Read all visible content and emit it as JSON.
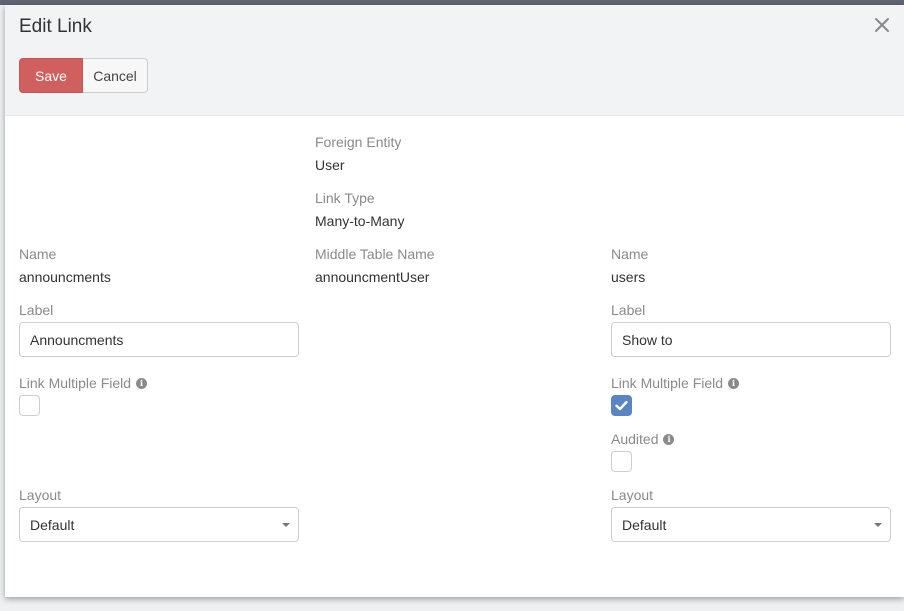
{
  "dialog": {
    "title": "Edit Link",
    "save_label": "Save",
    "cancel_label": "Cancel"
  },
  "center": {
    "foreign_entity_label": "Foreign Entity",
    "foreign_entity_value": "User",
    "link_type_label": "Link Type",
    "link_type_value": "Many-to-Many",
    "middle_table_label": "Middle Table Name",
    "middle_table_value": "announcmentUser"
  },
  "left": {
    "name_label": "Name",
    "name_value": "announcments",
    "label_label": "Label",
    "label_value": "Announcments",
    "link_multiple_label": "Link Multiple Field",
    "link_multiple_checked": false,
    "layout_label": "Layout",
    "layout_value": "Default"
  },
  "right": {
    "name_label": "Name",
    "name_value": "users",
    "label_label": "Label",
    "label_value": "Show to",
    "link_multiple_label": "Link Multiple Field",
    "link_multiple_checked": true,
    "audited_label": "Audited",
    "audited_checked": false,
    "layout_label": "Layout",
    "layout_value": "Default"
  },
  "icons": {
    "close": "close-icon",
    "info": "info-icon",
    "check": "check-icon",
    "caret": "caret-down-icon"
  },
  "colors": {
    "save_button": "#d05f5f",
    "checkbox_checked": "#5b84c4",
    "header_bg": "#f2f3f5"
  }
}
